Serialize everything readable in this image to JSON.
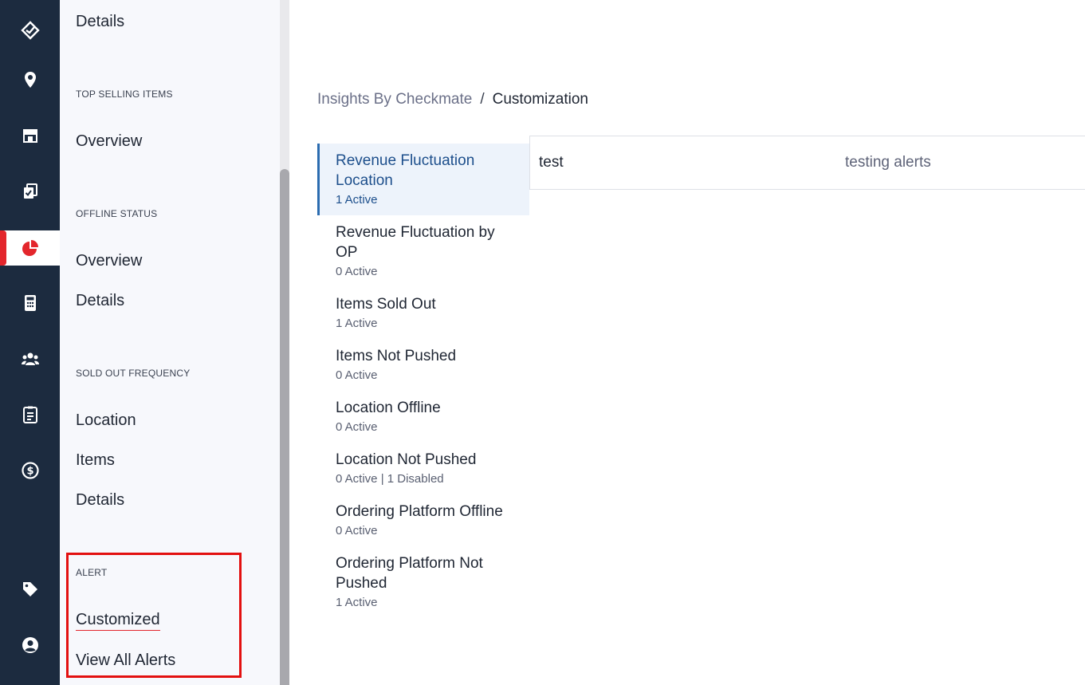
{
  "rail": {
    "items": [
      {
        "icon": "logo-icon"
      },
      {
        "icon": "location-pin-icon"
      },
      {
        "icon": "store-icon"
      },
      {
        "icon": "clipboard-check-icon"
      },
      {
        "icon": "pie-chart-icon",
        "active": true
      },
      {
        "icon": "calculator-icon"
      },
      {
        "icon": "users-icon"
      },
      {
        "icon": "document-icon"
      },
      {
        "icon": "dollar-cycle-icon"
      },
      {
        "icon": "tag-icon"
      },
      {
        "icon": "user-avatar-icon"
      }
    ],
    "active_color": "#e3262c"
  },
  "subnav": {
    "details_top": "Details",
    "top_selling": {
      "label": "TOP SELLING ITEMS",
      "items": [
        "Overview"
      ]
    },
    "offline_status": {
      "label": "OFFLINE STATUS",
      "items": [
        "Overview",
        "Details"
      ]
    },
    "sold_out_frequency": {
      "label": "SOLD OUT FREQUENCY",
      "items": [
        "Location",
        "Items",
        "Details"
      ]
    },
    "alert": {
      "label": "ALERT",
      "items": [
        "Customized",
        "View All Alerts"
      ]
    }
  },
  "breadcrumb": {
    "parent": "Insights By Checkmate",
    "separator": "/",
    "current": "Customization"
  },
  "alert_types": [
    {
      "title": "Revenue Fluctuation Location",
      "count": "1 Active",
      "selected": true
    },
    {
      "title": "Revenue Fluctuation by OP",
      "count": "0 Active"
    },
    {
      "title": "Items Sold Out",
      "count": "1 Active"
    },
    {
      "title": "Items Not Pushed",
      "count": "0 Active"
    },
    {
      "title": "Location Offline",
      "count": "0 Active"
    },
    {
      "title": "Location Not Pushed",
      "count": "0 Active | 1 Disabled"
    },
    {
      "title": "Ordering Platform Offline",
      "count": "0 Active"
    },
    {
      "title": "Ordering Platform Not Pushed",
      "count": "1 Active"
    }
  ],
  "detail_row": {
    "name": "test",
    "description": "testing alerts"
  }
}
